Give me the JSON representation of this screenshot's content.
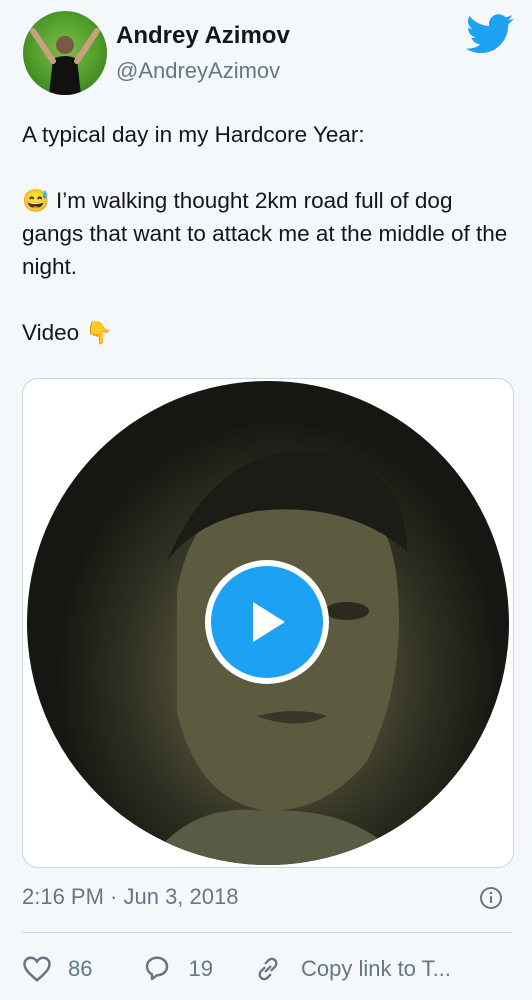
{
  "author": {
    "name": "Andrey Azimov",
    "handle": "@AndreyAzimov"
  },
  "tweet": {
    "line1": "A typical day in my Hardcore Year:",
    "emoji_sweat": "😅",
    "body": "I’m walking thought 2km road full of dog gangs that want to attack me at the middle of the night.",
    "video_label": "Video",
    "emoji_point": "👇"
  },
  "media": {
    "type": "video",
    "play_icon": "play-icon"
  },
  "meta": {
    "timestamp": "2:16 PM · Jun 3, 2018"
  },
  "actions": {
    "likes": "86",
    "replies": "19",
    "copy_link": "Copy link to T..."
  },
  "colors": {
    "brand": "#1da1f2",
    "muted": "#657786",
    "text": "#14171a"
  }
}
